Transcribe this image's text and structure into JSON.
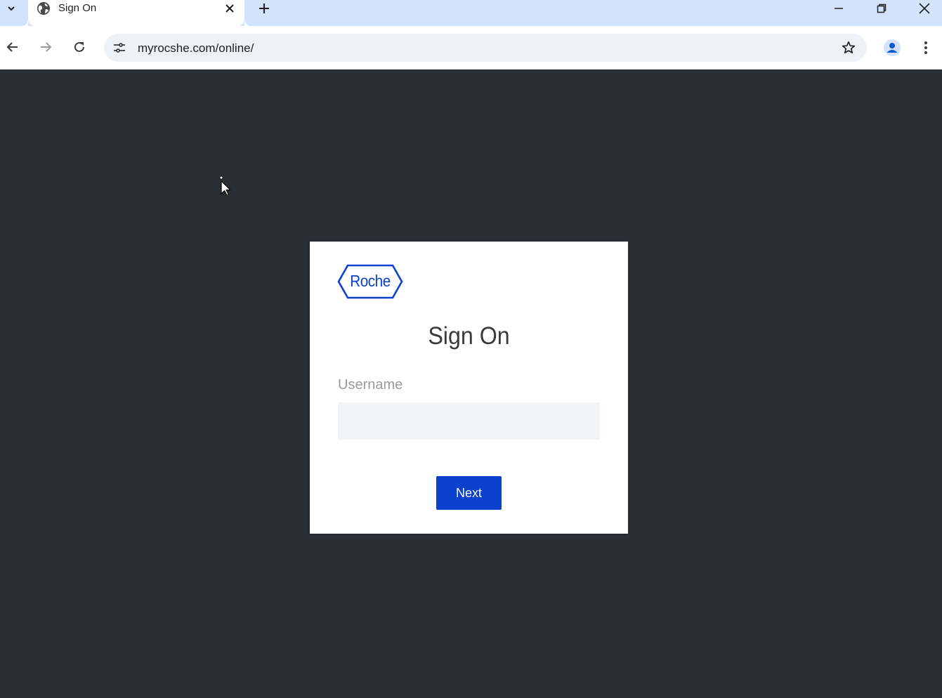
{
  "browser": {
    "tab": {
      "title": "Sign On",
      "favicon": "globe-icon"
    },
    "address_bar": {
      "url": "myrocshe.com/online/"
    },
    "icons": {
      "tab_search": "chevron-down-icon",
      "tab_close": "close-icon",
      "new_tab": "plus-icon",
      "back": "arrow-left-icon",
      "forward": "arrow-right-icon",
      "reload": "reload-icon",
      "site_info": "tune-icon",
      "bookmark": "star-icon",
      "profile": "person-icon",
      "menu": "more-vert-icon",
      "minimize": "minimize-icon",
      "restore": "restore-icon",
      "close_window": "close-icon"
    }
  },
  "login": {
    "logo_text": "Roche",
    "title": "Sign On",
    "username_label": "Username",
    "username_value": "",
    "next_label": "Next"
  },
  "colors": {
    "page_background": "#2a2f36",
    "brand_blue": "#0b41cd",
    "tab_strip": "#d3e3fd",
    "input_background": "#f1f4f5"
  }
}
